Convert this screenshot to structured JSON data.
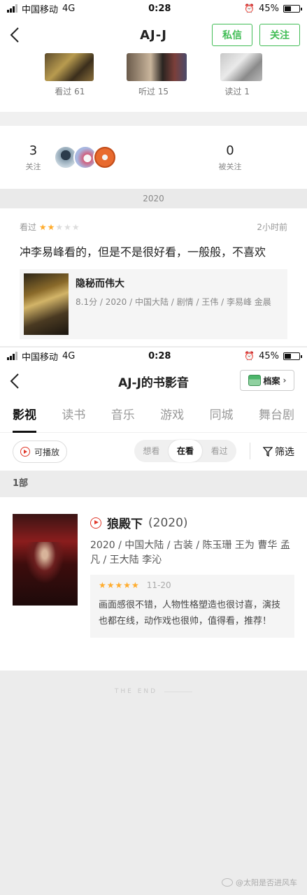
{
  "status": {
    "carrier": "中国移动",
    "network": "4G",
    "time": "0:28",
    "battery": "45%",
    "battery_level": 0.45
  },
  "profile": {
    "title": "AJ-J",
    "message_label": "私信",
    "follow_label": "关注",
    "stats": [
      {
        "label": "看过 61"
      },
      {
        "label": "听过 15"
      },
      {
        "label": "读过 1"
      }
    ],
    "following_count": "3",
    "following_label": "关注",
    "followers_count": "0",
    "followers_label": "被关注"
  },
  "feed": {
    "year": "2020",
    "action": "看过",
    "stars": "★★",
    "stars_off": "★★★",
    "time_ago": "2小时前",
    "comment": "冲李易峰看的，但是不是很好看，一般般，不喜欢",
    "movie_title": "隐秘而伟大",
    "movie_meta": "8.1分 / 2020 / 中国大陆 / 剧情 / 王伟 / 李易峰 金晨"
  },
  "media_page": {
    "title": "AJ-J的书影音",
    "archive_label": "档案",
    "tabs": [
      "影视",
      "读书",
      "音乐",
      "游戏",
      "同城",
      "舞台剧"
    ],
    "playable_label": "可播放",
    "segments": [
      "想看",
      "在看",
      "看过"
    ],
    "filter_label": "筛选",
    "count": "1部",
    "item": {
      "title": "狼殿下",
      "year": "(2020)",
      "meta": "2020 / 中国大陆 / 古装 / 陈玉珊 王为 曹华 孟凡 / 王大陆 李沁",
      "stars": "★★★★★",
      "date": "11-20",
      "review": "画面感很不错，人物性格塑造也很讨喜，演技也都在线，动作戏也很帅，值得看，推荐！"
    },
    "end_text": "THE END"
  },
  "watermark": "@太阳是否进风车"
}
